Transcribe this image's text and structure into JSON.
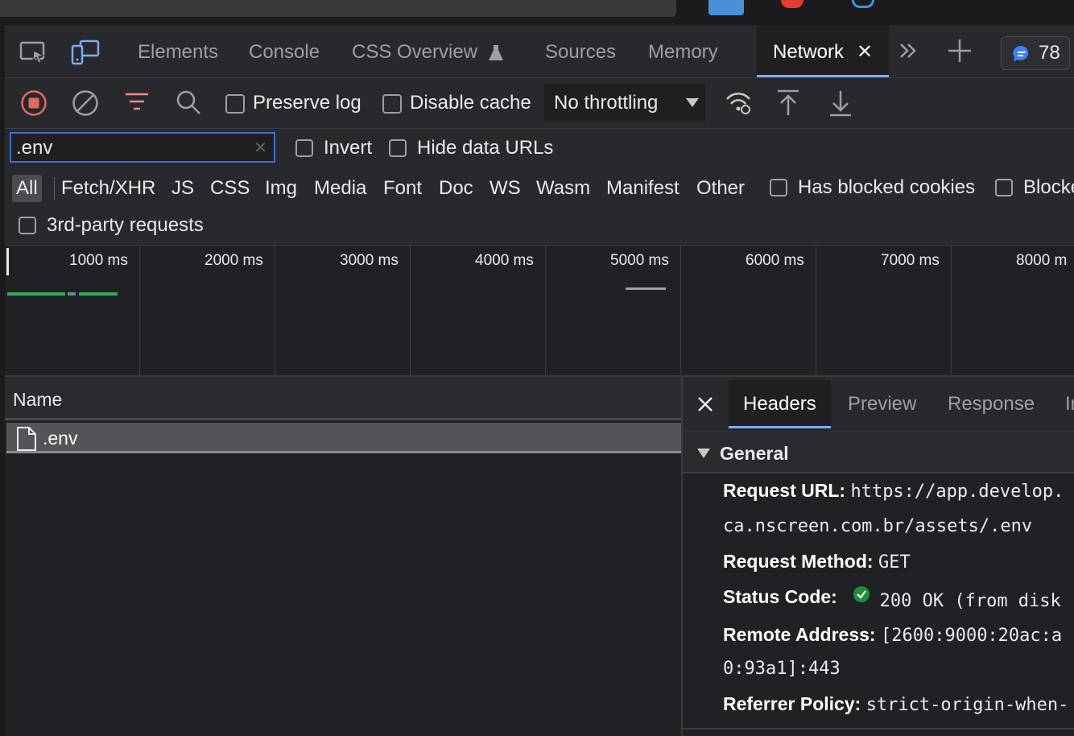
{
  "tabs": {
    "elements": "Elements",
    "console": "Console",
    "css_overview": "CSS Overview",
    "sources": "Sources",
    "memory": "Memory",
    "network": "Network",
    "issues_count": "78"
  },
  "toolbar": {
    "preserve_log": "Preserve log",
    "disable_cache": "Disable cache",
    "throttling": "No throttling"
  },
  "filter": {
    "value": ".env",
    "invert": "Invert",
    "hide_data_urls": "Hide data URLs",
    "types": [
      "All",
      "Fetch/XHR",
      "JS",
      "CSS",
      "Img",
      "Media",
      "Font",
      "Doc",
      "WS",
      "Wasm",
      "Manifest",
      "Other"
    ],
    "has_blocked_cookies": "Has blocked cookies",
    "blocked": "Blocke",
    "third_party": "3rd-party requests"
  },
  "timeline": {
    "ticks": [
      "1000 ms",
      "2000 ms",
      "3000 ms",
      "4000 ms",
      "5000 ms",
      "6000 ms",
      "7000 ms",
      "8000 m"
    ]
  },
  "requests": {
    "column_name": "Name",
    "rows": [
      {
        "name": ".env"
      }
    ]
  },
  "details": {
    "tabs": {
      "headers": "Headers",
      "preview": "Preview",
      "response": "Response",
      "initiator": "Ir"
    },
    "section_title": "General",
    "request_url_label": "Request URL:",
    "request_url_line1": "https://app.develop.",
    "request_url_line2": "ca.nscreen.com.br/assets/.env",
    "request_method_label": "Request Method:",
    "request_method": "GET",
    "status_code_label": "Status Code:",
    "status_code": "200 OK (from disk",
    "remote_address_label": "Remote Address:",
    "remote_address_line1": "[2600:9000:20ac:a",
    "remote_address_line2": "0:93a1]:443",
    "referrer_policy_label": "Referrer Policy:",
    "referrer_policy": "strict-origin-when-"
  },
  "colors": {
    "accent": "#7cacf8",
    "record": "#e46962",
    "status_ok": "#1e8e3e",
    "timeline_bar": "#34a853"
  }
}
